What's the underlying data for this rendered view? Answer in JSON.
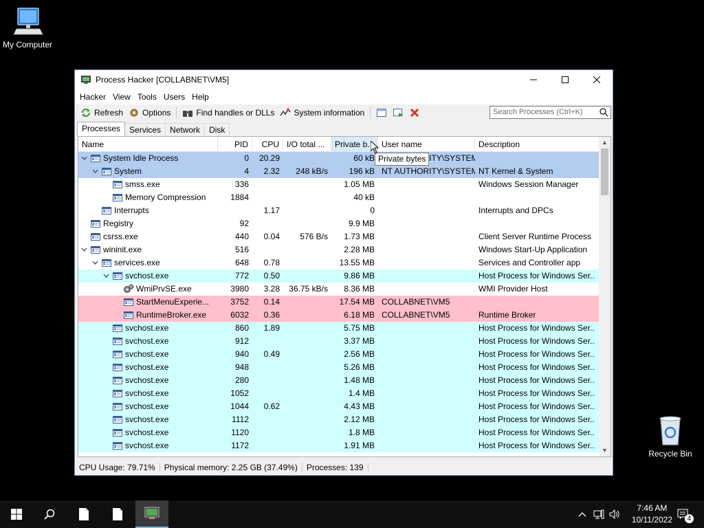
{
  "desktop": {
    "my_computer": "My Computer",
    "recycle_bin": "Recycle Bin"
  },
  "window": {
    "title": "Process Hacker [COLLABNET\\VM5]",
    "menu": [
      "Hacker",
      "View",
      "Tools",
      "Users",
      "Help"
    ],
    "toolbar": {
      "refresh": "Refresh",
      "options": "Options",
      "find_handles": "Find handles or DLLs",
      "system_info": "System information"
    },
    "search_placeholder": "Search Processes (Ctrl+K)",
    "tabs": [
      "Processes",
      "Services",
      "Network",
      "Disk"
    ],
    "columns": {
      "name": "Name",
      "pid": "PID",
      "cpu": "CPU",
      "io": "I/O total ...",
      "private": "Private b...",
      "user": "User name",
      "desc": "Description"
    },
    "tooltip": "Private bytes",
    "status": {
      "cpu": "CPU Usage: 79.71%",
      "memory": "Physical memory: 2.25 GB (37.49%)",
      "processes": "Processes: 139"
    }
  },
  "colors": {
    "system": "#b3cdf1",
    "service": "#cfffff",
    "own": "#ffc0cb",
    "normal": "#ffffff"
  },
  "processes": [
    {
      "name": "System Idle Process",
      "pid": "0",
      "cpu": "20.29",
      "io": "",
      "priv": "60 kB",
      "user": "NT AUTHORITY\\SYSTEM",
      "desc": "",
      "depth": 0,
      "toggle": "open",
      "color": "system",
      "icon": "window-icon"
    },
    {
      "name": "System",
      "pid": "4",
      "cpu": "2.32",
      "io": "248 kB/s",
      "priv": "196 kB",
      "user": "NT AUTHORITY\\SYSTEM",
      "desc": "NT Kernel & System",
      "depth": 1,
      "toggle": "open",
      "color": "system",
      "icon": "window-icon"
    },
    {
      "name": "smss.exe",
      "pid": "336",
      "cpu": "",
      "io": "",
      "priv": "1.05 MB",
      "user": "",
      "desc": "Windows Session Manager",
      "depth": 2,
      "toggle": "",
      "color": "normal",
      "icon": "window-icon"
    },
    {
      "name": "Memory Compression",
      "pid": "1884",
      "cpu": "",
      "io": "",
      "priv": "40 kB",
      "user": "",
      "desc": "",
      "depth": 2,
      "toggle": "",
      "color": "normal",
      "icon": "window-icon"
    },
    {
      "name": "Interrupts",
      "pid": "",
      "cpu": "1.17",
      "io": "",
      "priv": "0",
      "user": "",
      "desc": "Interrupts and DPCs",
      "depth": 1,
      "toggle": "",
      "color": "normal",
      "icon": "window-icon"
    },
    {
      "name": "Registry",
      "pid": "92",
      "cpu": "",
      "io": "",
      "priv": "9.9 MB",
      "user": "",
      "desc": "",
      "depth": 0,
      "toggle": "",
      "color": "normal",
      "icon": "window-icon"
    },
    {
      "name": "csrss.exe",
      "pid": "440",
      "cpu": "0.04",
      "io": "576 B/s",
      "priv": "1.73 MB",
      "user": "",
      "desc": "Client Server Runtime Process",
      "depth": 0,
      "toggle": "",
      "color": "normal",
      "icon": "window-icon"
    },
    {
      "name": "wininit.exe",
      "pid": "516",
      "cpu": "",
      "io": "",
      "priv": "2.28 MB",
      "user": "",
      "desc": "Windows Start-Up Application",
      "depth": 0,
      "toggle": "open",
      "color": "normal",
      "icon": "window-icon"
    },
    {
      "name": "services.exe",
      "pid": "648",
      "cpu": "0.78",
      "io": "",
      "priv": "13.55 MB",
      "user": "",
      "desc": "Services and Controller app",
      "depth": 1,
      "toggle": "open",
      "color": "normal",
      "icon": "window-icon"
    },
    {
      "name": "svchost.exe",
      "pid": "772",
      "cpu": "0.50",
      "io": "",
      "priv": "9.86 MB",
      "user": "",
      "desc": "Host Process for Windows Ser...",
      "depth": 2,
      "toggle": "open",
      "color": "service",
      "icon": "window-icon"
    },
    {
      "name": "WmiPrvSE.exe",
      "pid": "3980",
      "cpu": "3.28",
      "io": "36.75 kB/s",
      "priv": "8.36 MB",
      "user": "",
      "desc": "WMI Provider Host",
      "depth": 3,
      "toggle": "",
      "color": "normal",
      "icon": "gears-icon"
    },
    {
      "name": "StartMenuExperie...",
      "pid": "3752",
      "cpu": "0.14",
      "io": "",
      "priv": "17.54 MB",
      "user": "COLLABNET\\VM5",
      "desc": "",
      "depth": 3,
      "toggle": "",
      "color": "own",
      "icon": "window-icon"
    },
    {
      "name": "RuntimeBroker.exe",
      "pid": "6032",
      "cpu": "0.36",
      "io": "",
      "priv": "6.18 MB",
      "user": "COLLABNET\\VM5",
      "desc": "Runtime Broker",
      "depth": 3,
      "toggle": "",
      "color": "own",
      "icon": "window-icon"
    },
    {
      "name": "svchost.exe",
      "pid": "860",
      "cpu": "1.89",
      "io": "",
      "priv": "5.75 MB",
      "user": "",
      "desc": "Host Process for Windows Ser...",
      "depth": 2,
      "toggle": "",
      "color": "service",
      "icon": "window-icon"
    },
    {
      "name": "svchost.exe",
      "pid": "912",
      "cpu": "",
      "io": "",
      "priv": "3.37 MB",
      "user": "",
      "desc": "Host Process for Windows Ser...",
      "depth": 2,
      "toggle": "",
      "color": "service",
      "icon": "window-icon"
    },
    {
      "name": "svchost.exe",
      "pid": "940",
      "cpu": "0.49",
      "io": "",
      "priv": "2.56 MB",
      "user": "",
      "desc": "Host Process for Windows Ser...",
      "depth": 2,
      "toggle": "",
      "color": "service",
      "icon": "window-icon"
    },
    {
      "name": "svchost.exe",
      "pid": "948",
      "cpu": "",
      "io": "",
      "priv": "5.26 MB",
      "user": "",
      "desc": "Host Process for Windows Ser...",
      "depth": 2,
      "toggle": "",
      "color": "service",
      "icon": "window-icon"
    },
    {
      "name": "svchost.exe",
      "pid": "280",
      "cpu": "",
      "io": "",
      "priv": "1.48 MB",
      "user": "",
      "desc": "Host Process for Windows Ser...",
      "depth": 2,
      "toggle": "",
      "color": "service",
      "icon": "window-icon"
    },
    {
      "name": "svchost.exe",
      "pid": "1052",
      "cpu": "",
      "io": "",
      "priv": "1.4 MB",
      "user": "",
      "desc": "Host Process for Windows Ser...",
      "depth": 2,
      "toggle": "",
      "color": "service",
      "icon": "window-icon"
    },
    {
      "name": "svchost.exe",
      "pid": "1044",
      "cpu": "0.62",
      "io": "",
      "priv": "4.43 MB",
      "user": "",
      "desc": "Host Process for Windows Ser...",
      "depth": 2,
      "toggle": "",
      "color": "service",
      "icon": "window-icon"
    },
    {
      "name": "svchost.exe",
      "pid": "1112",
      "cpu": "",
      "io": "",
      "priv": "2.12 MB",
      "user": "",
      "desc": "Host Process for Windows Ser...",
      "depth": 2,
      "toggle": "",
      "color": "service",
      "icon": "window-icon"
    },
    {
      "name": "svchost.exe",
      "pid": "1120",
      "cpu": "",
      "io": "",
      "priv": "1.8 MB",
      "user": "",
      "desc": "Host Process for Windows Ser...",
      "depth": 2,
      "toggle": "",
      "color": "service",
      "icon": "window-icon"
    },
    {
      "name": "svchost.exe",
      "pid": "1172",
      "cpu": "",
      "io": "",
      "priv": "1.91 MB",
      "user": "",
      "desc": "Host Process for Windows Ser...",
      "depth": 2,
      "toggle": "",
      "color": "service",
      "icon": "window-icon"
    }
  ],
  "taskbar": {
    "time": "7:46 AM",
    "date": "10/11/2022",
    "notifications": "4"
  }
}
